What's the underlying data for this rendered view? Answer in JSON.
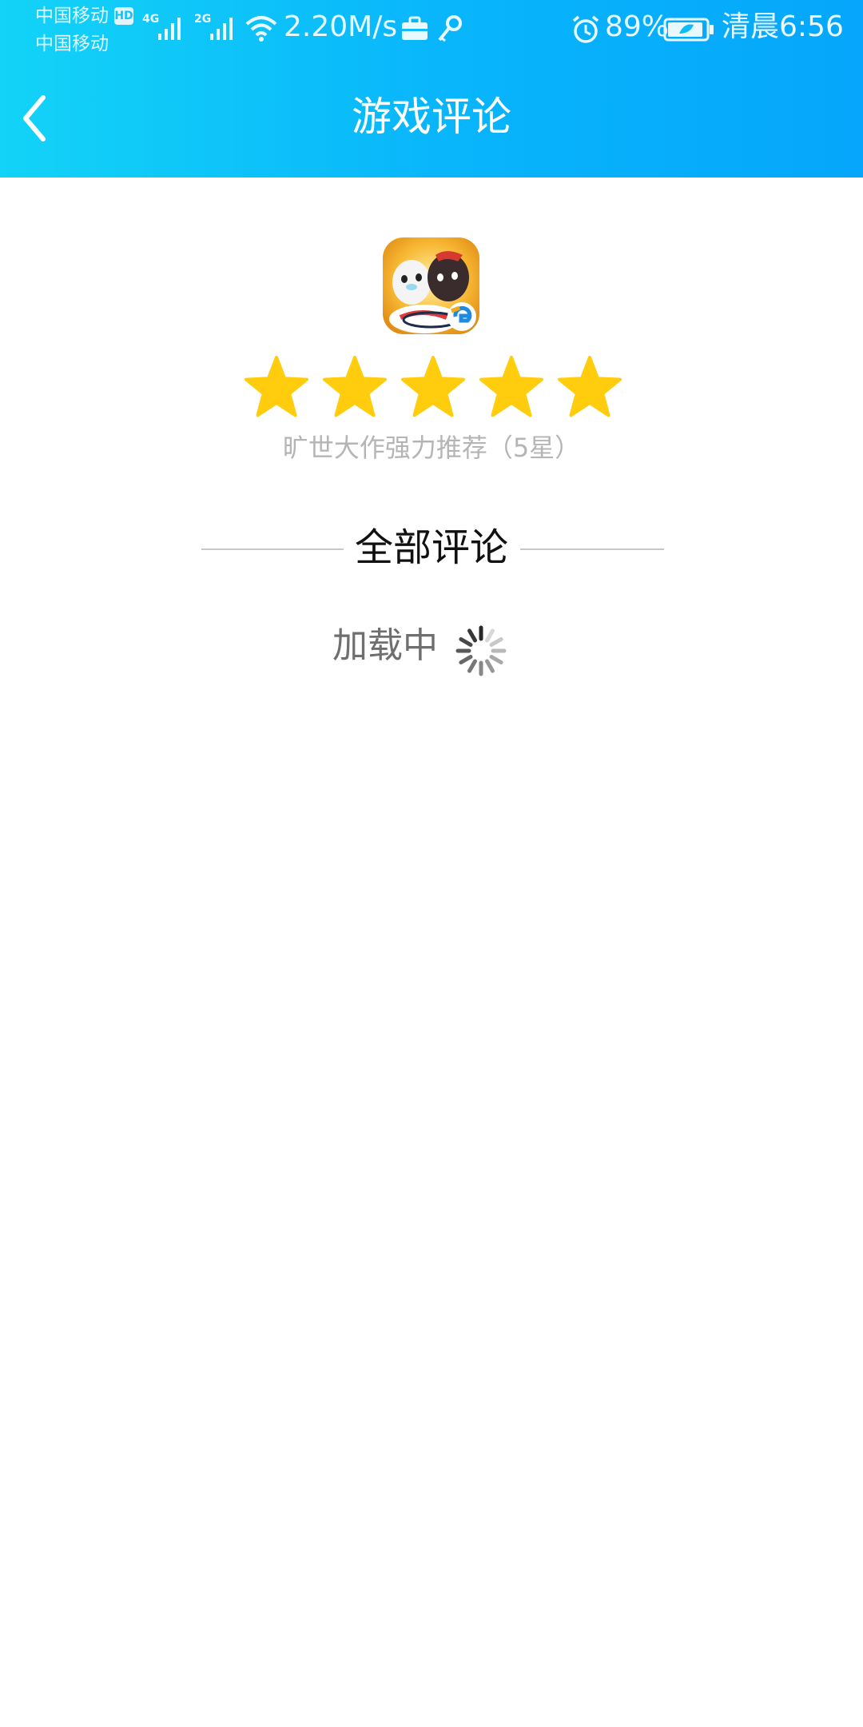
{
  "status_bar": {
    "carrier_1": "中国移动",
    "carrier_2": "中国移动",
    "hd_badge": "HD",
    "net_1": "4G",
    "net_2": "2G",
    "speed": "2.20M/s",
    "battery": "89%",
    "time": "清晨6:56",
    "icons": [
      "signal-icon",
      "wifi-icon",
      "briefcase-icon",
      "key-icon",
      "alarm-icon",
      "battery-icon"
    ]
  },
  "header": {
    "title": "游戏评论",
    "back_icon": "chevron-left-icon"
  },
  "game": {
    "icon": "game-app-icon",
    "rating": 5,
    "max_rating": 5,
    "rating_text": "旷世大作强力推荐（5星）"
  },
  "comments": {
    "section_title": "全部评论",
    "loading_text": "加载中"
  },
  "colors": {
    "header_start": "#13d3f7",
    "header_end": "#05a6fb",
    "star": "#ffcc0e",
    "rating_text": "#b5b5b5",
    "divider": "#c8c8c8"
  }
}
